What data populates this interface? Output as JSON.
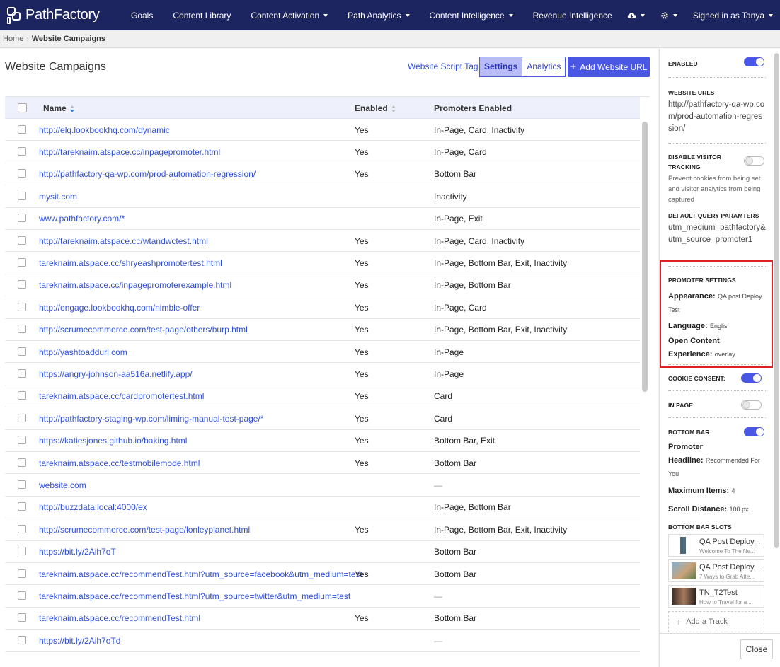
{
  "app": {
    "logo_text": "PathFactory"
  },
  "nav": {
    "items": [
      {
        "label": "Goals",
        "dropdown": false
      },
      {
        "label": "Content Library",
        "dropdown": false
      },
      {
        "label": "Content Activation",
        "dropdown": true
      },
      {
        "label": "Path Analytics",
        "dropdown": true
      },
      {
        "label": "Content Intelligence",
        "dropdown": true
      },
      {
        "label": "Revenue Intelligence",
        "dropdown": false
      }
    ],
    "cloud_icon": "cloud-icon",
    "gear_icon": "gear-icon",
    "user_label": "Signed in as Tanya"
  },
  "breadcrumb": {
    "home": "Home",
    "current": "Website Campaigns"
  },
  "page": {
    "title": "Website Campaigns",
    "script_tag_link": "Website Script Tag",
    "tabs": [
      {
        "label": "Settings",
        "active": true
      },
      {
        "label": "Analytics",
        "active": false
      }
    ],
    "add_button": "Add Website URL"
  },
  "table": {
    "columns": {
      "name": "Name",
      "enabled": "Enabled",
      "promoters": "Promoters Enabled"
    },
    "rows": [
      {
        "name": "http://elq.lookbookhq.com/dynamic",
        "enabled": "Yes",
        "promoters": "In-Page, Card, Inactivity"
      },
      {
        "name": "http://tareknaim.atspace.cc/inpagepromoter.html",
        "enabled": "Yes",
        "promoters": "In-Page, Card"
      },
      {
        "name": "http://pathfactory-qa-wp.com/prod-automation-regression/",
        "enabled": "Yes",
        "promoters": "Bottom Bar"
      },
      {
        "name": "mysit.com",
        "enabled": "",
        "promoters": "Inactivity"
      },
      {
        "name": "www.pathfactory.com/*",
        "enabled": "",
        "promoters": "In-Page, Exit"
      },
      {
        "name": "http://tareknaim.atspace.cc/wtandwctest.html",
        "enabled": "Yes",
        "promoters": "In-Page, Card, Inactivity"
      },
      {
        "name": "tareknaim.atspace.cc/shryeashpromotertest.html",
        "enabled": "Yes",
        "promoters": "In-Page, Bottom Bar, Exit, Inactivity"
      },
      {
        "name": "tareknaim.atspace.cc/inpagepromoterexample.html",
        "enabled": "Yes",
        "promoters": "In-Page, Bottom Bar"
      },
      {
        "name": "http://engage.lookbookhq.com/nimble-offer",
        "enabled": "Yes",
        "promoters": "In-Page, Card"
      },
      {
        "name": "http://scrumecommerce.com/test-page/others/burp.html",
        "enabled": "Yes",
        "promoters": "In-Page, Bottom Bar, Exit, Inactivity"
      },
      {
        "name": "http://yashtoaddurl.com",
        "enabled": "Yes",
        "promoters": "In-Page"
      },
      {
        "name": "https://angry-johnson-aa516a.netlify.app/",
        "enabled": "Yes",
        "promoters": "In-Page"
      },
      {
        "name": "tareknaim.atspace.cc/cardpromotertest.html",
        "enabled": "Yes",
        "promoters": "Card"
      },
      {
        "name": "http://pathfactory-staging-wp.com/liming-manual-test-page/*",
        "enabled": "Yes",
        "promoters": "Card"
      },
      {
        "name": "https://katiesjones.github.io/baking.html",
        "enabled": "Yes",
        "promoters": "Bottom Bar, Exit"
      },
      {
        "name": "tareknaim.atspace.cc/testmobilemode.html",
        "enabled": "Yes",
        "promoters": "Bottom Bar"
      },
      {
        "name": "website.com",
        "enabled": "",
        "promoters": "—"
      },
      {
        "name": "http://buzzdata.local:4000/ex",
        "enabled": "",
        "promoters": "In-Page, Bottom Bar"
      },
      {
        "name": "http://scrumecommerce.com/test-page/lonleyplanet.html",
        "enabled": "Yes",
        "promoters": "In-Page, Bottom Bar, Exit, Inactivity"
      },
      {
        "name": "https://bit.ly/2Aih7oT",
        "enabled": "",
        "promoters": "Bottom Bar"
      },
      {
        "name": "tareknaim.atspace.cc/recommendTest.html?utm_source=facebook&utm_medium=test",
        "enabled": "Yes",
        "promoters": "Bottom Bar"
      },
      {
        "name": "tareknaim.atspace.cc/recommendTest.html?utm_source=twitter&utm_medium=test",
        "enabled": "",
        "promoters": "—"
      },
      {
        "name": "tareknaim.atspace.cc/recommendTest.html",
        "enabled": "Yes",
        "promoters": "Bottom Bar"
      },
      {
        "name": "https://bit.ly/2Aih7oTd",
        "enabled": "",
        "promoters": "—"
      }
    ]
  },
  "panel": {
    "enabled_label": "ENABLED",
    "website_urls_label": "WEBSITE URLS",
    "website_url": "http://pathfactory-qa-wp.com/prod-automation-regression/",
    "disable_tracking_label": "DISABLE VISITOR TRACKING",
    "disable_tracking_desc": "Prevent cookies from being set and visitor analytics from being captured",
    "query_params_label": "DEFAULT QUERY PARAMTERS",
    "query_params": "utm_medium=pathfactory&utm_source=promoter1",
    "promoter_settings_label": "PROMOTER SETTINGS",
    "appearance_label": "Appearance:",
    "appearance_value": "QA post Deploy Test",
    "language_label": "Language:",
    "language_value": "English",
    "open_content_label_1": "Open Content",
    "open_content_label_2": "Experience:",
    "open_content_value": "overlay",
    "cookie_consent_label": "COOKIE CONSENT:",
    "in_page_label": "IN PAGE:",
    "bottom_bar_label": "BOTTOM BAR",
    "promoter_headline_label_1": "Promoter",
    "promoter_headline_label_2": "Headline:",
    "promoter_headline_value": "Recommended For You",
    "max_items_label": "Maximum Items:",
    "max_items_value": "4",
    "scroll_distance_label": "Scroll Distance:",
    "scroll_distance_value": "100 px",
    "slots_label": "BOTTOM BAR SLOTS",
    "slots": [
      {
        "title": "QA Post Deploy...",
        "subtitle": "Welcome To The Ne..."
      },
      {
        "title": "QA Post Deploy...",
        "subtitle": "7 Ways to Grab Atte..."
      },
      {
        "title": "TN_T2Test",
        "subtitle": "How to Travel for a ..."
      }
    ],
    "add_track": "Add a Track",
    "close": "Close"
  }
}
